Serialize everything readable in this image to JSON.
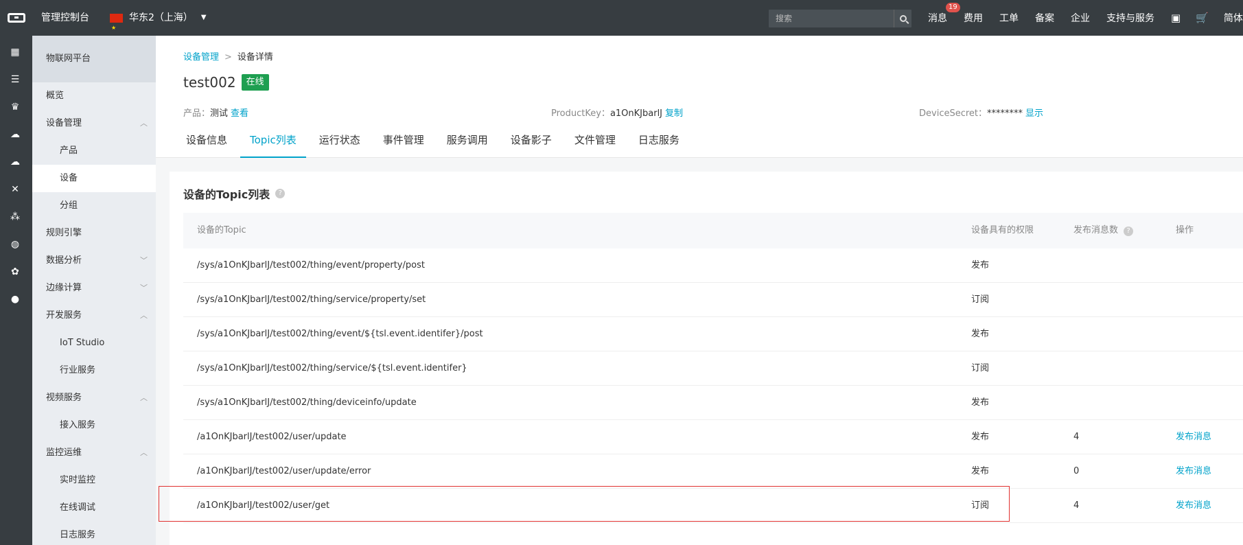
{
  "topbar": {
    "console_label": "管理控制台",
    "region": "华东2（上海）",
    "search_placeholder": "搜索",
    "nav": [
      {
        "label": "消息",
        "badge": "19"
      },
      {
        "label": "费用"
      },
      {
        "label": "工单"
      },
      {
        "label": "备案"
      },
      {
        "label": "企业"
      },
      {
        "label": "支持与服务"
      }
    ],
    "user_partial": "简体"
  },
  "sidemenu": {
    "header": "物联网平台",
    "items": [
      {
        "label": "概览",
        "level": 1
      },
      {
        "label": "设备管理",
        "level": 1,
        "expanded": true
      },
      {
        "label": "产品",
        "level": 2
      },
      {
        "label": "设备",
        "level": 2,
        "active": true
      },
      {
        "label": "分组",
        "level": 2
      },
      {
        "label": "规则引擎",
        "level": 1
      },
      {
        "label": "数据分析",
        "level": 1,
        "expanded": false
      },
      {
        "label": "边缘计算",
        "level": 1,
        "expanded": false
      },
      {
        "label": "开发服务",
        "level": 1,
        "expanded": true
      },
      {
        "label": "IoT Studio",
        "level": 2
      },
      {
        "label": "行业服务",
        "level": 2
      },
      {
        "label": "视频服务",
        "level": 1,
        "expanded": true
      },
      {
        "label": "接入服务",
        "level": 2
      },
      {
        "label": "监控运维",
        "level": 1,
        "expanded": true
      },
      {
        "label": "实时监控",
        "level": 2
      },
      {
        "label": "在线调试",
        "level": 2
      },
      {
        "label": "日志服务",
        "level": 2
      }
    ]
  },
  "breadcrumb": {
    "parent": "设备管理",
    "separator": ">",
    "current": "设备详情"
  },
  "device": {
    "name": "test002",
    "status": "在线",
    "product_key_label": "产品：",
    "product_value": "测试",
    "product_link": "查看",
    "pk_label": "ProductKey：",
    "pk_value": "a1OnKJbarlJ",
    "pk_link": "复制",
    "ds_label": "DeviceSecret：",
    "ds_value": "********",
    "ds_link": "显示"
  },
  "tabs": [
    "设备信息",
    "Topic列表",
    "运行状态",
    "事件管理",
    "服务调用",
    "设备影子",
    "文件管理",
    "日志服务"
  ],
  "active_tab": "Topic列表",
  "panel": {
    "title": "设备的Topic列表",
    "columns": [
      "设备的Topic",
      "设备具有的权限",
      "发布消息数",
      "操作"
    ],
    "rows": [
      {
        "topic": "/sys/a1OnKJbarlJ/test002/thing/event/property/post",
        "perm": "发布",
        "count": "",
        "op": ""
      },
      {
        "topic": "/sys/a1OnKJbarlJ/test002/thing/service/property/set",
        "perm": "订阅",
        "count": "",
        "op": ""
      },
      {
        "topic": "/sys/a1OnKJbarlJ/test002/thing/event/${tsl.event.identifer}/post",
        "perm": "发布",
        "count": "",
        "op": ""
      },
      {
        "topic": "/sys/a1OnKJbarlJ/test002/thing/service/${tsl.event.identifer}",
        "perm": "订阅",
        "count": "",
        "op": ""
      },
      {
        "topic": "/sys/a1OnKJbarlJ/test002/thing/deviceinfo/update",
        "perm": "发布",
        "count": "",
        "op": ""
      },
      {
        "topic": "/a1OnKJbarlJ/test002/user/update",
        "perm": "发布",
        "count": "4",
        "op": "发布消息"
      },
      {
        "topic": "/a1OnKJbarlJ/test002/user/update/error",
        "perm": "发布",
        "count": "0",
        "op": "发布消息"
      },
      {
        "topic": "/a1OnKJbarlJ/test002/user/get",
        "perm": "订阅",
        "count": "4",
        "op": "发布消息"
      }
    ]
  },
  "icons": [
    "apps-icon",
    "server-icon",
    "trophy-icon",
    "cloud-icon",
    "cloud-up-icon",
    "tools-icon",
    "network-icon",
    "globe-icon",
    "bug-icon",
    "circle-icon"
  ]
}
